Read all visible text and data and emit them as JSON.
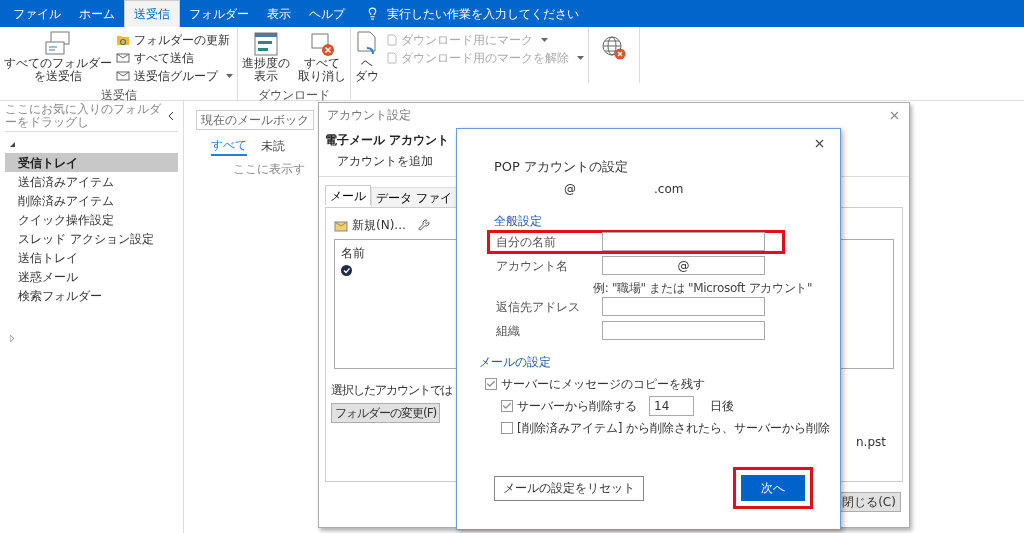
{
  "ribbon_tabs": [
    {
      "label": "ファイル",
      "selected": false
    },
    {
      "label": "ホーム",
      "selected": false
    },
    {
      "label": "送受信",
      "selected": true
    },
    {
      "label": "フォルダー",
      "selected": false
    },
    {
      "label": "表示",
      "selected": false
    },
    {
      "label": "ヘルプ",
      "selected": false
    }
  ],
  "tell_me": "実行したい作業を入力してください",
  "send_receive_group": {
    "label": "送受信",
    "big_button": [
      "すべてのフォルダー",
      "を送受信"
    ],
    "small_buttons": [
      {
        "label": "フォルダーの更新",
        "dropdown": false,
        "disabled": false
      },
      {
        "label": "すべて送信",
        "dropdown": false,
        "disabled": false
      },
      {
        "label": "送受信グループ",
        "dropdown": true,
        "disabled": false
      }
    ]
  },
  "download_group": {
    "label": "ダウンロード",
    "buttons": [
      [
        "進捗度の",
        "表示"
      ],
      [
        "すべて",
        "取り消し"
      ]
    ]
  },
  "server_group": {
    "big_button": [
      "ヘ",
      "ダウ"
    ],
    "small_buttons": [
      {
        "label": "ダウンロード用にマーク",
        "dropdown": true,
        "disabled": true
      },
      {
        "label": "ダウンロード用のマークを解除",
        "dropdown": true,
        "disabled": true
      }
    ]
  },
  "favorites_hint": "ここにお気に入りのフォルダーをドラッグし",
  "folders": [
    {
      "label": "受信トレイ",
      "selected": true
    },
    {
      "label": "送信済みアイテム",
      "selected": false
    },
    {
      "label": "削除済みアイテム",
      "selected": false
    },
    {
      "label": "クイック操作設定",
      "selected": false
    },
    {
      "label": "スレッド アクション設定",
      "selected": false
    },
    {
      "label": "送信トレイ",
      "selected": false
    },
    {
      "label": "迷惑メール",
      "selected": false
    },
    {
      "label": "検索フォルダー",
      "selected": false
    }
  ],
  "search": {
    "placeholder": "現在のメールボック"
  },
  "filter_tabs": [
    {
      "label": "すべて",
      "selected": true
    },
    {
      "label": "未読",
      "selected": false
    }
  ],
  "empty_message": "ここに表示す",
  "account_settings": {
    "title": "アカウント設定",
    "heading": "電子メール アカウント",
    "subheading": "アカウントを追加",
    "tabs": [
      {
        "label": "メール",
        "selected": true
      },
      {
        "label": "データ ファイ",
        "selected": false
      }
    ],
    "new_button": "新規(N)...",
    "list_header": "名前",
    "selected_account_text": "選択したアカウントでは",
    "change_folder_button": "フォルダーの変更(F)",
    "data_file": "n.pst",
    "close_button": "閉じる(C)"
  },
  "pop_dialog": {
    "title": "POP アカウントの設定",
    "email_at": "@",
    "email_domain": ".com",
    "general_heading": "全般設定",
    "fields": [
      {
        "label": "自分の名前",
        "highlighted": true
      },
      {
        "label": "アカウント名",
        "value": "@",
        "hint": "例: \"職場\" または \"Microsoft アカウント\"",
        "highlighted": false
      },
      {
        "label": "返信先アドレス",
        "highlighted": false
      },
      {
        "label": "組織",
        "highlighted": false
      }
    ],
    "mail_heading": "メールの設定",
    "options": [
      {
        "kind": "checkbox",
        "label": "サーバーにメッセージのコピーを残す",
        "checked": true,
        "children": [
          {
            "kind": "days",
            "label": "サーバーから削除する",
            "checked": true,
            "days": "14",
            "unit": "日後"
          },
          {
            "kind": "checkbox",
            "label": "[削除済みアイテム] から削除されたら、サーバーから削除",
            "checked": false
          }
        ]
      }
    ],
    "reset_button": "メールの設定をリセット",
    "next_button": {
      "label": "次へ",
      "highlighted": true
    }
  }
}
